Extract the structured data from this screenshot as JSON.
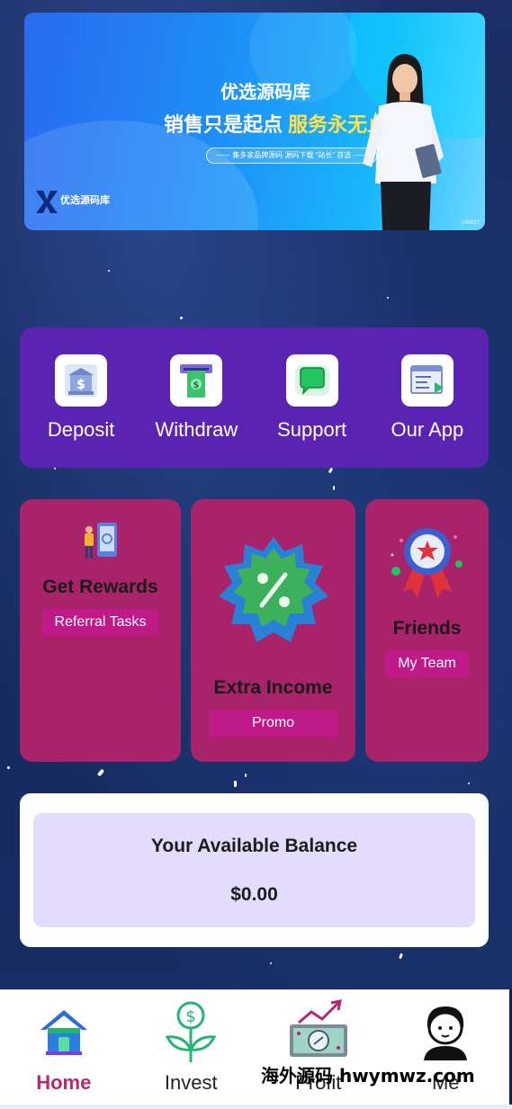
{
  "banner": {
    "title": "优选源码库",
    "subtitle_part1": "销售只是起点",
    "subtitle_part2": "服务永无止境",
    "pill": "—— 集多家品牌源码 源码下载 “站长” 首选 ——",
    "logo_text": "优选源码库",
    "tag": "24683T"
  },
  "actions": [
    {
      "label": "Deposit",
      "icon": "bank-icon"
    },
    {
      "label": "Withdraw",
      "icon": "atm-cash-icon"
    },
    {
      "label": "Support",
      "icon": "chat-bubble-icon"
    },
    {
      "label": "Our App",
      "icon": "app-window-icon"
    }
  ],
  "cards": {
    "rewards": {
      "title": "Get Rewards",
      "button": "Referral Tasks"
    },
    "income": {
      "title": "Extra Income",
      "button": "Promo"
    },
    "friends": {
      "title": "Friends",
      "button": "My Team"
    }
  },
  "balance": {
    "label": "Your Available Balance",
    "value": "$0.00"
  },
  "nav": [
    {
      "label": "Home",
      "icon": "home-icon",
      "active": true
    },
    {
      "label": "Invest",
      "icon": "money-plant-icon",
      "active": false
    },
    {
      "label": "Profit",
      "icon": "profit-chart-icon",
      "active": false
    },
    {
      "label": "Me",
      "icon": "user-avatar-icon",
      "active": false
    }
  ],
  "watermark": "海外源码 hwymwz.com",
  "colors": {
    "accent": "#b5286e",
    "actions_bg": "#5b23b1",
    "card_bg": "#a8236a",
    "balance_bg": "#e4dcfc"
  }
}
